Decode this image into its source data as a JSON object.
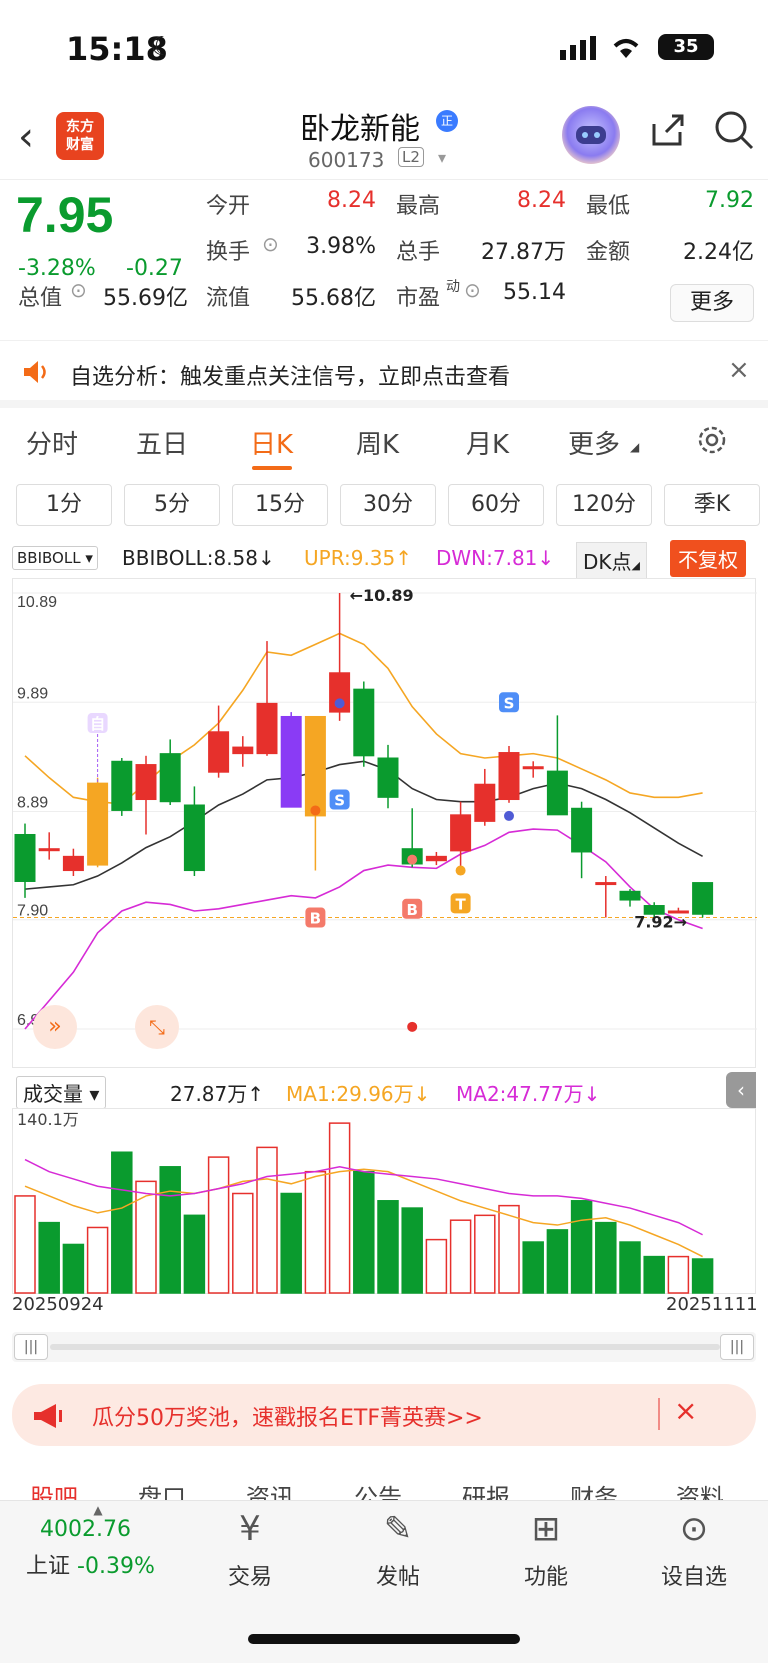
{
  "status": {
    "time": "15:18",
    "battery": "35"
  },
  "header": {
    "logo_line1": "东方",
    "logo_line2": "财富",
    "name": "卧龙新能",
    "badge": "正",
    "code": "600173",
    "level": "L2"
  },
  "quote": {
    "price": "7.95",
    "pct": "-3.28%",
    "chg": "-0.27",
    "open_label": "今开",
    "open": "8.24",
    "high_label": "最高",
    "high": "8.24",
    "low_label": "最低",
    "low": "7.92",
    "turnover_label": "换手",
    "turnover": "3.98%",
    "volume_label": "总手",
    "volume": "27.87万",
    "amount_label": "金额",
    "amount": "2.24亿",
    "mktcap_label": "总值",
    "mktcap": "55.69亿",
    "float_label": "流值",
    "float": "55.68亿",
    "pe_label": "市盈",
    "pe_sup": "动",
    "pe": "55.14",
    "more": "更多"
  },
  "alert": {
    "text": "自选分析：触发重点关注信号，立即点击查看"
  },
  "tabs": [
    "分时",
    "五日",
    "日K",
    "周K",
    "月K",
    "更多"
  ],
  "periods": [
    "1分",
    "5分",
    "15分",
    "30分",
    "60分",
    "120分",
    "季K"
  ],
  "indicator": {
    "select": "BBIBOLL",
    "bbi": "BBIBOLL:8.58↓",
    "upr": "UPR:9.35↑",
    "dwn": "DWN:7.81↓",
    "dk": "DK点",
    "adj": "不复权"
  },
  "volume": {
    "select": "成交量",
    "vol": "27.87万↑",
    "ma1": "MA1:29.96万↓",
    "ma2": "MA2:47.77万↓",
    "max": "140.1万"
  },
  "dates": {
    "start": "20250924",
    "end": "20251111"
  },
  "banner": {
    "text": "瓜分50万奖池，速戳报名ETF菁英赛>>"
  },
  "subtabs": [
    "股吧",
    "盘口",
    "资讯",
    "公告",
    "研报",
    "财务",
    "资料"
  ],
  "bottom": {
    "index_value": "4002.76",
    "index_name": "上证",
    "index_pct": "-0.39%",
    "items": [
      "交易",
      "发帖",
      "功能",
      "设自选"
    ]
  },
  "colors": {
    "up": "#e6302c",
    "down": "#0a9b2e",
    "accent": "#f36b17",
    "upr": "#f5a623",
    "dwn": "#d62bd6"
  },
  "chart_data": {
    "type": "candlestick",
    "ylim": [
      6.9,
      10.89
    ],
    "yticks": [
      "10.89",
      "9.89",
      "8.89",
      "7.90",
      "6.90"
    ],
    "annotations": {
      "high": "←10.89",
      "low": "7.92→",
      "marker_zi": "自",
      "buy": "B",
      "sell": "S",
      "t": "T"
    },
    "candles": [
      {
        "o": 8.68,
        "c": 8.25,
        "h": 8.78,
        "l": 8.1
      },
      {
        "o": 8.55,
        "c": 8.55,
        "h": 8.7,
        "l": 8.45
      },
      {
        "o": 8.35,
        "c": 8.48,
        "h": 8.55,
        "l": 8.3
      },
      {
        "o": 8.4,
        "c": 9.15,
        "h": 9.2,
        "l": 8.38
      },
      {
        "o": 9.35,
        "c": 8.9,
        "h": 9.38,
        "l": 8.85
      },
      {
        "o": 9.0,
        "c": 9.32,
        "h": 9.4,
        "l": 8.68
      },
      {
        "o": 9.42,
        "c": 8.98,
        "h": 9.55,
        "l": 8.95
      },
      {
        "o": 8.95,
        "c": 8.35,
        "h": 9.12,
        "l": 8.3
      },
      {
        "o": 9.25,
        "c": 9.62,
        "h": 9.86,
        "l": 9.2
      },
      {
        "o": 9.42,
        "c": 9.48,
        "h": 9.58,
        "l": 9.3
      },
      {
        "o": 9.42,
        "c": 9.88,
        "h": 10.45,
        "l": 9.4
      },
      {
        "o": 9.76,
        "c": 8.93,
        "h": 9.8,
        "l": 8.93
      },
      {
        "o": 9.76,
        "c": 8.85,
        "h": 9.76,
        "l": 8.35
      },
      {
        "o": 9.8,
        "c": 10.16,
        "h": 10.89,
        "l": 9.72
      },
      {
        "o": 10.01,
        "c": 9.4,
        "h": 10.08,
        "l": 9.3
      },
      {
        "o": 9.38,
        "c": 9.02,
        "h": 9.5,
        "l": 8.92
      },
      {
        "o": 8.55,
        "c": 8.41,
        "h": 8.92,
        "l": 8.38
      },
      {
        "o": 8.44,
        "c": 8.48,
        "h": 8.52,
        "l": 8.4
      },
      {
        "o": 8.53,
        "c": 8.86,
        "h": 8.98,
        "l": 8.39
      },
      {
        "o": 8.8,
        "c": 9.14,
        "h": 9.28,
        "l": 8.76
      },
      {
        "o": 9.0,
        "c": 9.43,
        "h": 9.49,
        "l": 8.97
      },
      {
        "o": 9.3,
        "c": 9.3,
        "h": 9.35,
        "l": 9.2
      },
      {
        "o": 9.26,
        "c": 8.86,
        "h": 9.77,
        "l": 8.86
      },
      {
        "o": 8.92,
        "c": 8.52,
        "h": 8.98,
        "l": 8.28
      },
      {
        "o": 8.24,
        "c": 8.24,
        "h": 8.3,
        "l": 7.92
      },
      {
        "o": 8.16,
        "c": 8.08,
        "h": 8.18,
        "l": 8.02
      },
      {
        "o": 8.03,
        "c": 7.95,
        "h": 8.06,
        "l": 7.92
      },
      {
        "o": 7.98,
        "c": 7.98,
        "h": 8.01,
        "l": 7.96
      },
      {
        "o": 8.24,
        "c": 7.95,
        "h": 8.24,
        "l": 7.92
      }
    ],
    "bbi": [
      8.18,
      8.2,
      8.22,
      8.3,
      8.42,
      8.56,
      8.66,
      8.8,
      8.95,
      9.05,
      9.18,
      9.2,
      9.25,
      9.32,
      9.35,
      9.27,
      9.1,
      9.0,
      8.98,
      8.98,
      9.02,
      9.1,
      9.15,
      9.1,
      9.0,
      8.88,
      8.74,
      8.6,
      8.48
    ],
    "upr": [
      9.4,
      9.2,
      9.02,
      8.98,
      8.96,
      9.15,
      9.35,
      9.5,
      9.7,
      10.0,
      10.35,
      10.32,
      10.42,
      10.52,
      10.42,
      10.2,
      9.85,
      9.6,
      9.42,
      9.38,
      9.4,
      9.42,
      9.38,
      9.28,
      9.18,
      9.06,
      9.02,
      9.02,
      9.06
    ],
    "dwn": [
      6.9,
      7.16,
      7.42,
      7.78,
      7.98,
      8.06,
      8.04,
      7.98,
      8.0,
      8.04,
      8.08,
      8.12,
      8.1,
      8.2,
      8.35,
      8.4,
      8.38,
      8.37,
      8.5,
      8.58,
      8.7,
      8.73,
      8.72,
      8.58,
      8.43,
      8.2,
      8.0,
      7.9,
      7.82
    ],
    "volume_ylim": [
      0,
      140.1
    ],
    "volumes": [
      80,
      58,
      40,
      54,
      116,
      92,
      104,
      64,
      112,
      82,
      120,
      82,
      100,
      140,
      100,
      76,
      70,
      44,
      60,
      64,
      72,
      42,
      52,
      76,
      58,
      42,
      30,
      30,
      28
    ],
    "vol_up": [
      true,
      false,
      false,
      true,
      false,
      true,
      false,
      false,
      true,
      true,
      true,
      false,
      true,
      true,
      false,
      false,
      false,
      true,
      true,
      true,
      true,
      false,
      false,
      false,
      false,
      false,
      false,
      true,
      false
    ],
    "ma1": [
      88,
      80,
      72,
      66,
      70,
      80,
      84,
      82,
      86,
      92,
      94,
      90,
      96,
      100,
      102,
      100,
      92,
      84,
      76,
      70,
      64,
      58,
      56,
      60,
      62,
      56,
      48,
      40,
      30
    ],
    "ma2": [
      110,
      100,
      94,
      88,
      85,
      82,
      80,
      82,
      86,
      90,
      96,
      98,
      100,
      104,
      100,
      98,
      96,
      94,
      90,
      86,
      82,
      80,
      80,
      78,
      74,
      70,
      64,
      58,
      48
    ]
  }
}
